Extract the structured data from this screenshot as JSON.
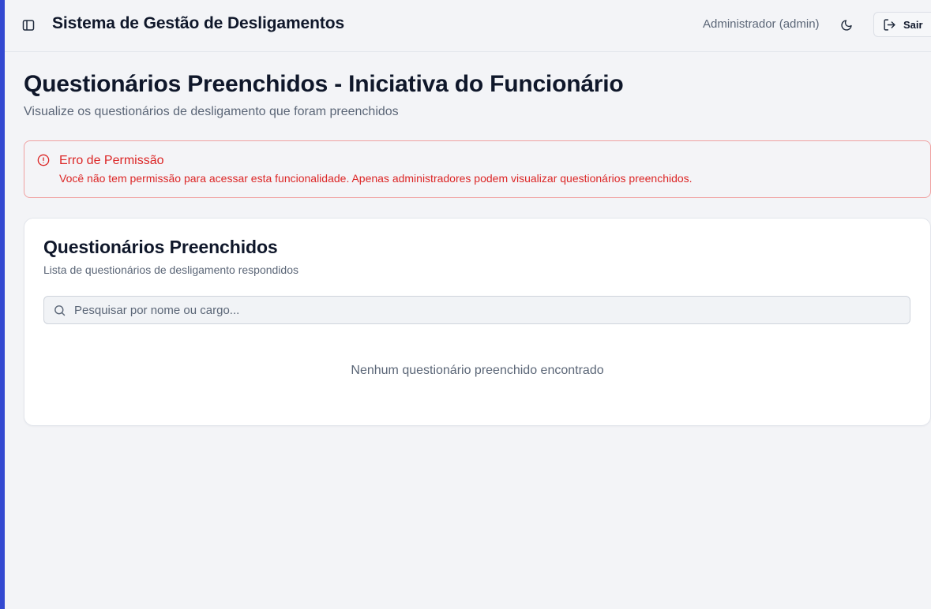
{
  "header": {
    "app_title": "Sistema de Gestão de Desligamentos",
    "user_label": "Administrador (admin)",
    "logout_label": "Sair"
  },
  "page": {
    "title": "Questionários Preenchidos - Iniciativa do Funcionário",
    "subtitle": "Visualize os questionários de desligamento que foram preenchidos"
  },
  "alert": {
    "title": "Erro de Permissão",
    "message": "Você não tem permissão para acessar esta funcionalidade. Apenas administradores podem visualizar questionários preenchidos.",
    "icon": "alert-circle-icon"
  },
  "card": {
    "title": "Questionários Preenchidos",
    "subtitle": "Lista de questionários de desligamento respondidos",
    "search": {
      "placeholder": "Pesquisar por nome ou cargo...",
      "value": ""
    },
    "empty_message": "Nenhum questionário preenchido encontrado"
  },
  "colors": {
    "accent_stripe": "#3349d1",
    "error": "#dc2626",
    "text_primary": "#0f172a",
    "text_muted": "#5b6677",
    "background": "#f3f4f7"
  },
  "icons": {
    "sidebar_toggle": "panel-left-icon",
    "theme_toggle": "moon-icon",
    "logout": "log-out-icon",
    "search": "search-icon"
  }
}
